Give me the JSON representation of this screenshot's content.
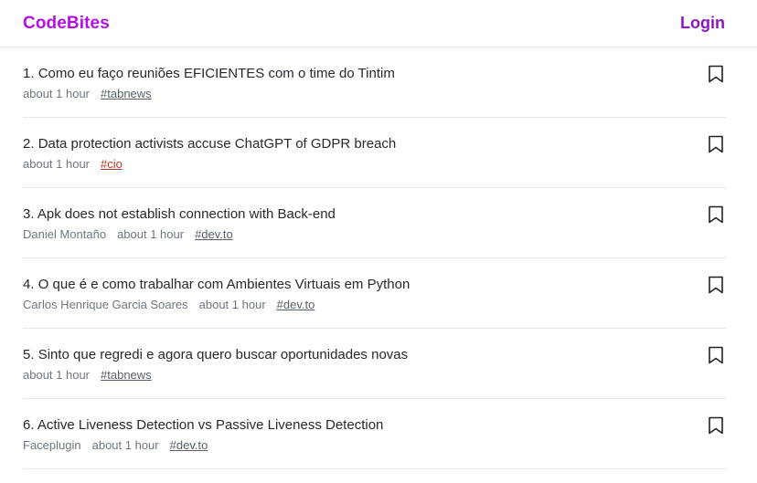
{
  "header": {
    "brand": "CodeBites",
    "login_label": "Login"
  },
  "posts": [
    {
      "num": "1.",
      "title": "Como eu faço reuniões EFICIENTES com o time do Tintim",
      "author": "",
      "time": "about 1 hour",
      "tag": "#tabnews",
      "tag_color": "#57606a"
    },
    {
      "num": "2.",
      "title": "Data protection activists accuse ChatGPT of GDPR breach",
      "author": "",
      "time": "about 1 hour",
      "tag": "#cio",
      "tag_color": "#c0392b"
    },
    {
      "num": "3.",
      "title": "Apk does not establish connection with Back-end",
      "author": "Daniel Montaño",
      "time": "about 1 hour",
      "tag": "#dev.to",
      "tag_color": "#57606a"
    },
    {
      "num": "4.",
      "title": "O que é e como trabalhar com Ambientes Virtuais em Python",
      "author": "Carlos Henrique Garcia Soares",
      "time": "about 1 hour",
      "tag": "#dev.to",
      "tag_color": "#57606a"
    },
    {
      "num": "5.",
      "title": "Sinto que regredi e agora quero buscar oportunidades novas",
      "author": "",
      "time": "about 1 hour",
      "tag": "#tabnews",
      "tag_color": "#57606a"
    },
    {
      "num": "6.",
      "title": "Active Liveness Detection vs Passive Liveness Detection",
      "author": "Faceplugin",
      "time": "about 1 hour",
      "tag": "#dev.to",
      "tag_color": "#57606a"
    }
  ],
  "icons": {
    "bookmark": "bookmark-icon"
  },
  "colors": {
    "brand": "#b30fe6",
    "login": "#8a17c8",
    "cio_tag": "#c0392b"
  }
}
